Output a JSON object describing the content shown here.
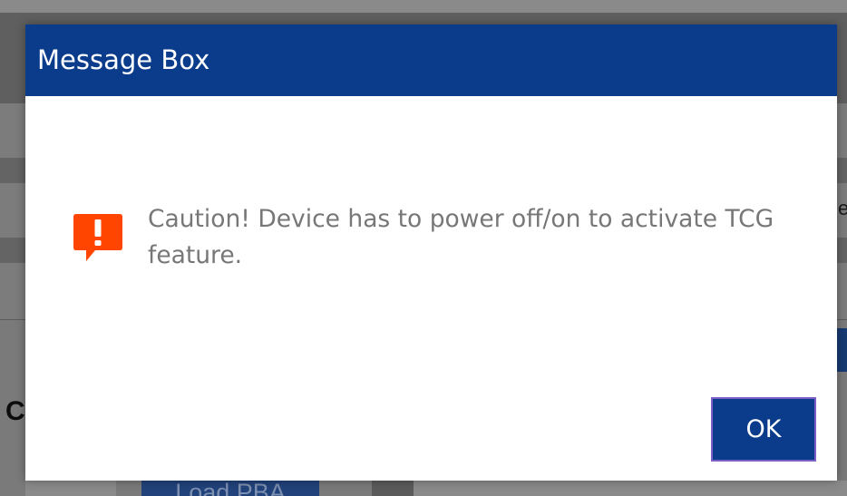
{
  "dialog": {
    "title": "Message Box",
    "message": "Caution! Device has to power off/on to activate TCG feature.",
    "icon": "caution-alert-icon",
    "ok_label": "OK",
    "colors": {
      "titlebar": "#0b3c8c",
      "icon": "#ff4500",
      "message_text": "#777777",
      "button": "#0b3c8c",
      "button_focus_border": "#7b5fc6"
    }
  },
  "background": {
    "partial_heading": "C",
    "partial_edge_text": "e",
    "load_button_label": "Load PBA"
  }
}
